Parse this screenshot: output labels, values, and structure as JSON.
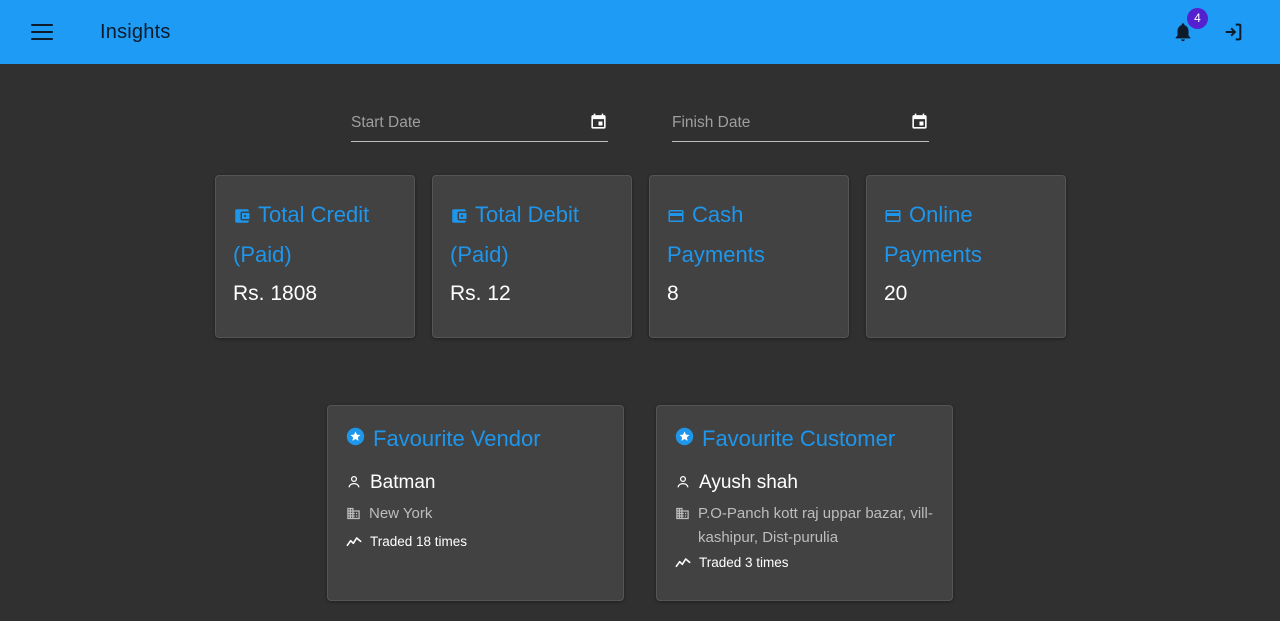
{
  "appbar": {
    "menu_icon": "hamburger-menu-icon",
    "title": "Insights",
    "notification_icon": "bell-icon",
    "notification_count": "4",
    "logout_icon": "logout-icon",
    "background_color": "#1e9bf5",
    "badge_color": "#5521ce"
  },
  "filters": {
    "start_date": {
      "label": "Start Date",
      "placeholder": "Start Date",
      "value": "",
      "icon": "calendar-icon"
    },
    "finish_date": {
      "label": "Finish Date",
      "placeholder": "Finish Date",
      "value": "",
      "icon": "calendar-icon"
    }
  },
  "stats": [
    {
      "title": "Total Credit (Paid)",
      "value": "Rs. 1808",
      "icon": "wallet-icon"
    },
    {
      "title": "Total Debit (Paid)",
      "value": "Rs. 12",
      "icon": "wallet-icon"
    },
    {
      "title": "Cash Payments",
      "value": "8",
      "icon": "credit-card-icon"
    },
    {
      "title": "Online Payments",
      "value": "20",
      "icon": "credit-card-icon"
    }
  ],
  "favourites": [
    {
      "title": "Favourite Vendor",
      "title_icon": "star-circle-icon",
      "name": "Batman",
      "name_icon": "person-icon",
      "address": "New York",
      "address_icon": "building-icon",
      "traded": "Traded 18 times",
      "traded_icon": "trending-up-icon"
    },
    {
      "title": "Favourite Customer",
      "title_icon": "star-circle-icon",
      "name": "Ayush shah",
      "name_icon": "person-icon",
      "address": "P.O-Panch kott raj uppar bazar, vill-kashipur, Dist-purulia",
      "address_icon": "building-icon",
      "traded": "Traded 3 times",
      "traded_icon": "trending-up-icon"
    }
  ],
  "theme": {
    "page_background": "#303030",
    "card_background": "#424242",
    "accent": "#1e96ec",
    "text_primary": "#ffffff",
    "text_secondary": "#bdbdbd"
  }
}
